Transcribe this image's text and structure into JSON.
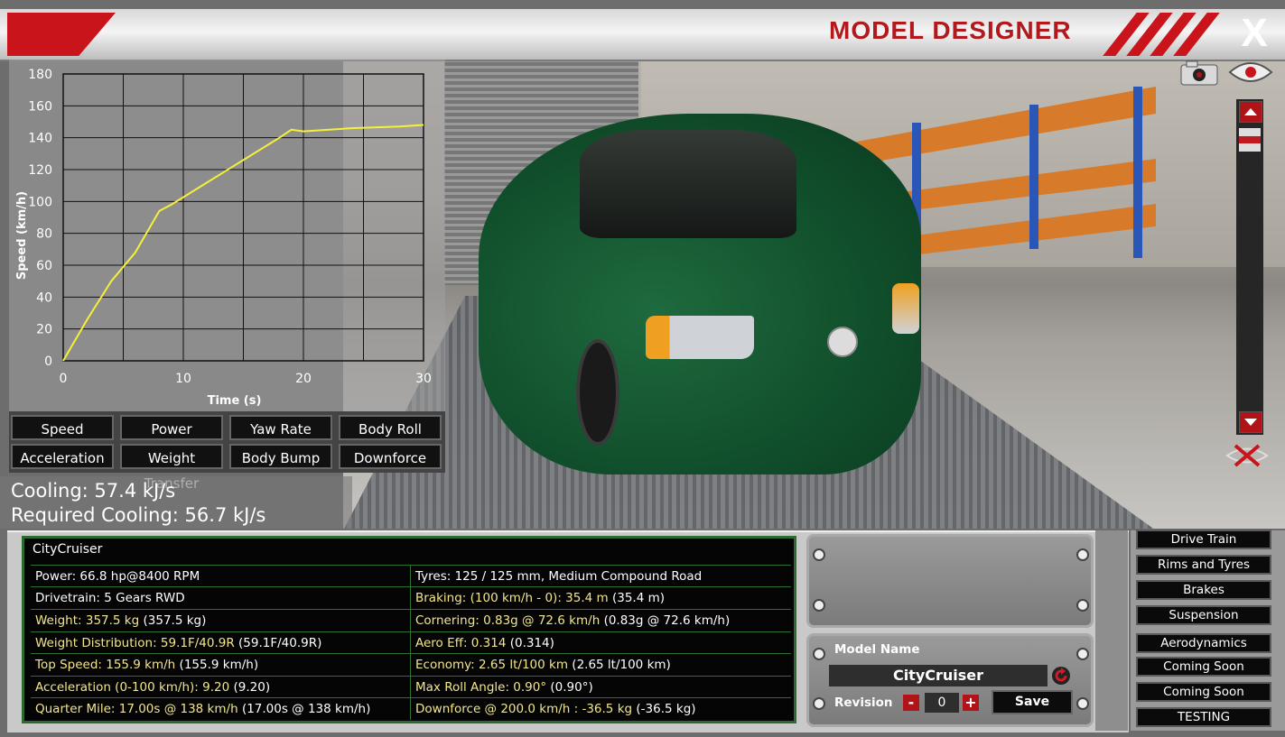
{
  "header": {
    "title": "MODEL DESIGNER",
    "close_label": "X"
  },
  "chart_data": {
    "type": "line",
    "xlabel": "Time (s)",
    "ylabel": "Speed (km/h)",
    "xlim": [
      0,
      30
    ],
    "ylim": [
      0,
      180
    ],
    "x_ticks": [
      0,
      10,
      20,
      30
    ],
    "y_ticks": [
      0,
      20,
      40,
      60,
      80,
      100,
      120,
      140,
      160,
      180
    ],
    "grid": true,
    "line_color": "#f5f03a",
    "series": [
      {
        "x": [
          0,
          2,
          4,
          6,
          8,
          9,
          12,
          15,
          18,
          19,
          20,
          24,
          28,
          30
        ],
        "y": [
          0,
          26,
          50,
          68,
          94,
          98,
          112,
          126,
          140,
          145,
          144,
          146,
          147,
          148
        ]
      }
    ]
  },
  "stat_buttons": [
    "Speed",
    "Power",
    "Yaw Rate",
    "Body Roll",
    "Acceleration",
    "Weight Transfer",
    "Body Bump",
    "Downforce"
  ],
  "cooling": {
    "cooling": "Cooling: 57.4 kJ/s",
    "required": "Required Cooling: 56.7 kJ/s"
  },
  "specs": {
    "name": "CityCruiser",
    "left": [
      {
        "label": "Power: 66.8 hp@8400 RPM",
        "value": ""
      },
      {
        "label": "Drivetrain: 5 Gears RWD",
        "value": ""
      },
      {
        "label": "Weight: 357.5 kg",
        "value": "(357.5 kg)"
      },
      {
        "label": "Weight Distribution: 59.1F/40.9R",
        "value": "(59.1F/40.9R)"
      },
      {
        "label": "Top Speed: 155.9 km/h",
        "value": "(155.9 km/h)"
      },
      {
        "label": "Acceleration (0-100 km/h): 9.20",
        "value": "(9.20)"
      },
      {
        "label": "Quarter Mile: 17.00s @ 138 km/h",
        "value": "(17.00s @ 138 km/h)"
      }
    ],
    "right": [
      {
        "label": "Tyres: 125 / 125 mm, Medium Compound Road",
        "value": ""
      },
      {
        "label": "Braking: (100 km/h - 0): 35.4 m",
        "value": "(35.4 m)"
      },
      {
        "label": "Cornering: 0.83g @ 72.6 km/h",
        "value": "(0.83g @ 72.6 km/h)"
      },
      {
        "label": "Aero Eff: 0.314",
        "value": "(0.314)"
      },
      {
        "label": "Economy: 2.65 lt/100 km",
        "value": "(2.65 lt/100 km)"
      },
      {
        "label": "Max Roll Angle: 0.90°",
        "value": "(0.90°)"
      },
      {
        "label": "Downforce @ 200.0 km/h : -36.5 kg",
        "value": "(-36.5 kg)"
      }
    ],
    "highlight_color": "#f2e68c"
  },
  "model": {
    "name_label": "Model Name",
    "name_value": "CityCruiser",
    "revision_label": "Revision",
    "revision_value": "0",
    "minus": "-",
    "plus": "+",
    "save_label": "Save"
  },
  "categories": [
    "Drive Train",
    "Rims and Tyres",
    "Brakes",
    "Suspension",
    "Aerodynamics",
    "Coming Soon",
    "Coming Soon",
    "TESTING"
  ],
  "icons": [
    "camera-icon",
    "eye-icon",
    "scroll-up-icon",
    "scroll-down-icon",
    "hide-view-icon",
    "refresh-icon"
  ]
}
